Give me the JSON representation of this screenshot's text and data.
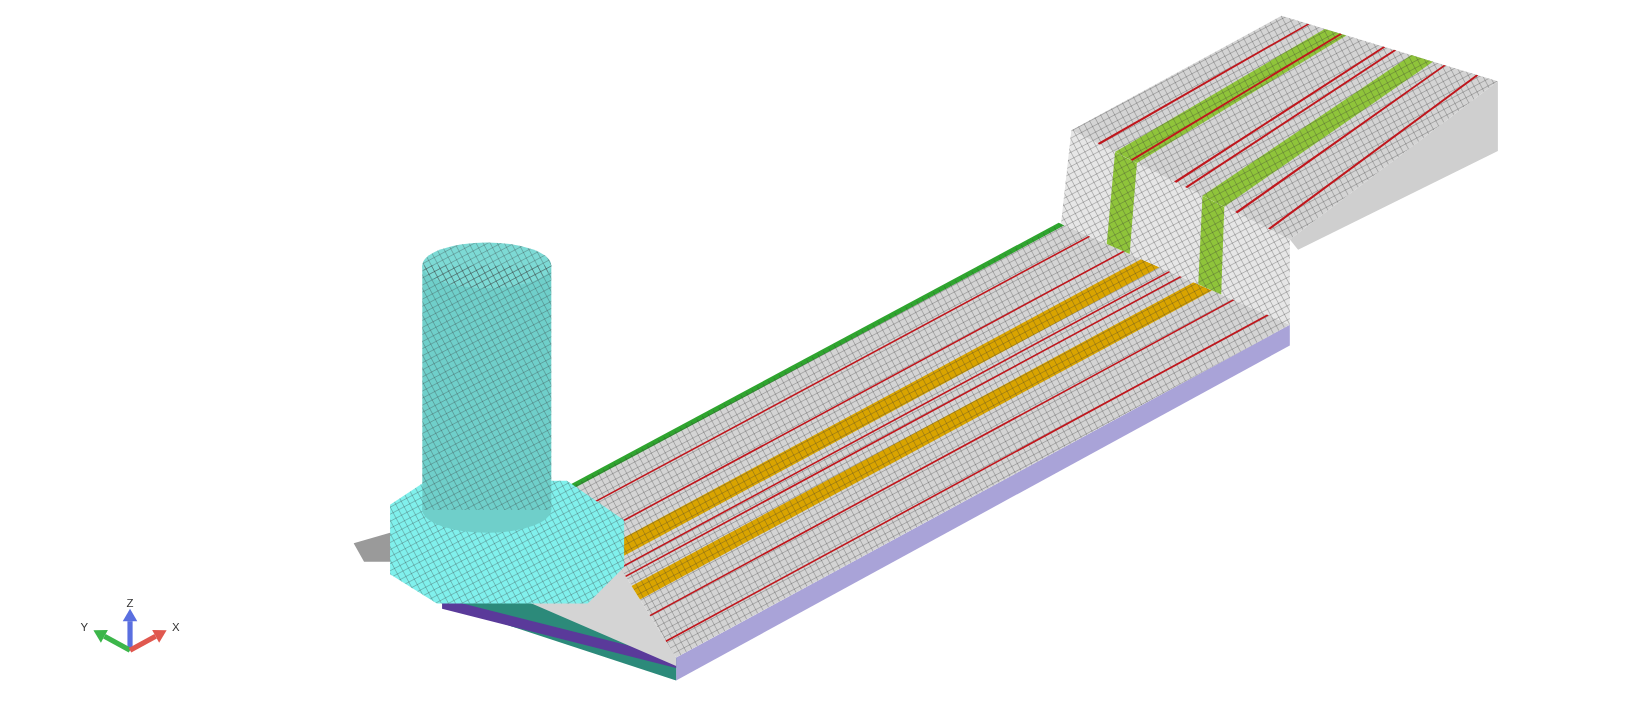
{
  "viewport": {
    "triad": {
      "axes": [
        {
          "label": "Z",
          "color": "#5a6fe0"
        },
        {
          "label": "Y",
          "color": "#3cb64a"
        },
        {
          "label": "X",
          "color": "#e0584f"
        }
      ]
    }
  }
}
